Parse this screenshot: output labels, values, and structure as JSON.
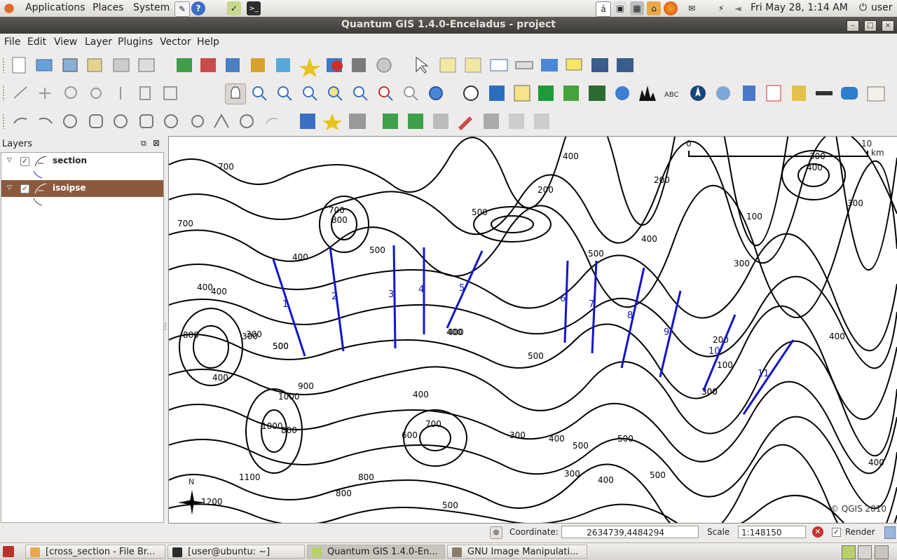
{
  "top_panel": {
    "menus": [
      "Applications",
      "Places",
      "System"
    ],
    "clock": "Fri May 28,  1:14 AM",
    "user": "user"
  },
  "window": {
    "title": "Quantum GIS 1.4.0-Enceladus - project"
  },
  "menubar": [
    "File",
    "Edit",
    "View",
    "Layer",
    "Plugins",
    "Vector",
    "Help"
  ],
  "layers_panel": {
    "title": "Layers",
    "layers": [
      {
        "name": "section",
        "checked": true
      },
      {
        "name": "isoipse",
        "checked": true
      }
    ]
  },
  "map": {
    "scalebar": {
      "start": "0",
      "end": "10",
      "unit": "km"
    },
    "copyright": "© QGIS 2010",
    "north_label": "N",
    "contour_labels": [
      "700",
      "700",
      "800",
      "700",
      "400",
      "400",
      "400",
      "300",
      "800",
      "400",
      "500",
      "900",
      "1000",
      "1000",
      "800",
      "1100",
      "1200",
      "500",
      "300",
      "400",
      "500",
      "400",
      "500",
      "700",
      "600",
      "800",
      "800",
      "500",
      "400",
      "500",
      "300",
      "300",
      "400",
      "500",
      "500",
      "400",
      "500",
      "300",
      "500",
      "400",
      "200",
      "400",
      "200",
      "300",
      "400",
      "300",
      "300",
      "100",
      "100",
      "200",
      "300",
      "400",
      "400"
    ],
    "section_labels": [
      "1",
      "2",
      "3",
      "4",
      "5",
      "6",
      "7",
      "8",
      "9",
      "10",
      "11"
    ]
  },
  "statusbar": {
    "coordinate_label": "Coordinate:",
    "coordinate_value": "2634739,4484294",
    "scale_label": "Scale",
    "scale_value": "1:148150",
    "render_label": "Render"
  },
  "taskbar": {
    "tasks": [
      "[cross_section - File Br...",
      "[user@ubuntu: ~]",
      "Quantum GIS 1.4.0-En...",
      "GNU Image Manipulati..."
    ]
  },
  "colors": {
    "selection": "#8b5a3e",
    "section_lines": "#1414c8",
    "title_bar": "#3c3b37"
  }
}
